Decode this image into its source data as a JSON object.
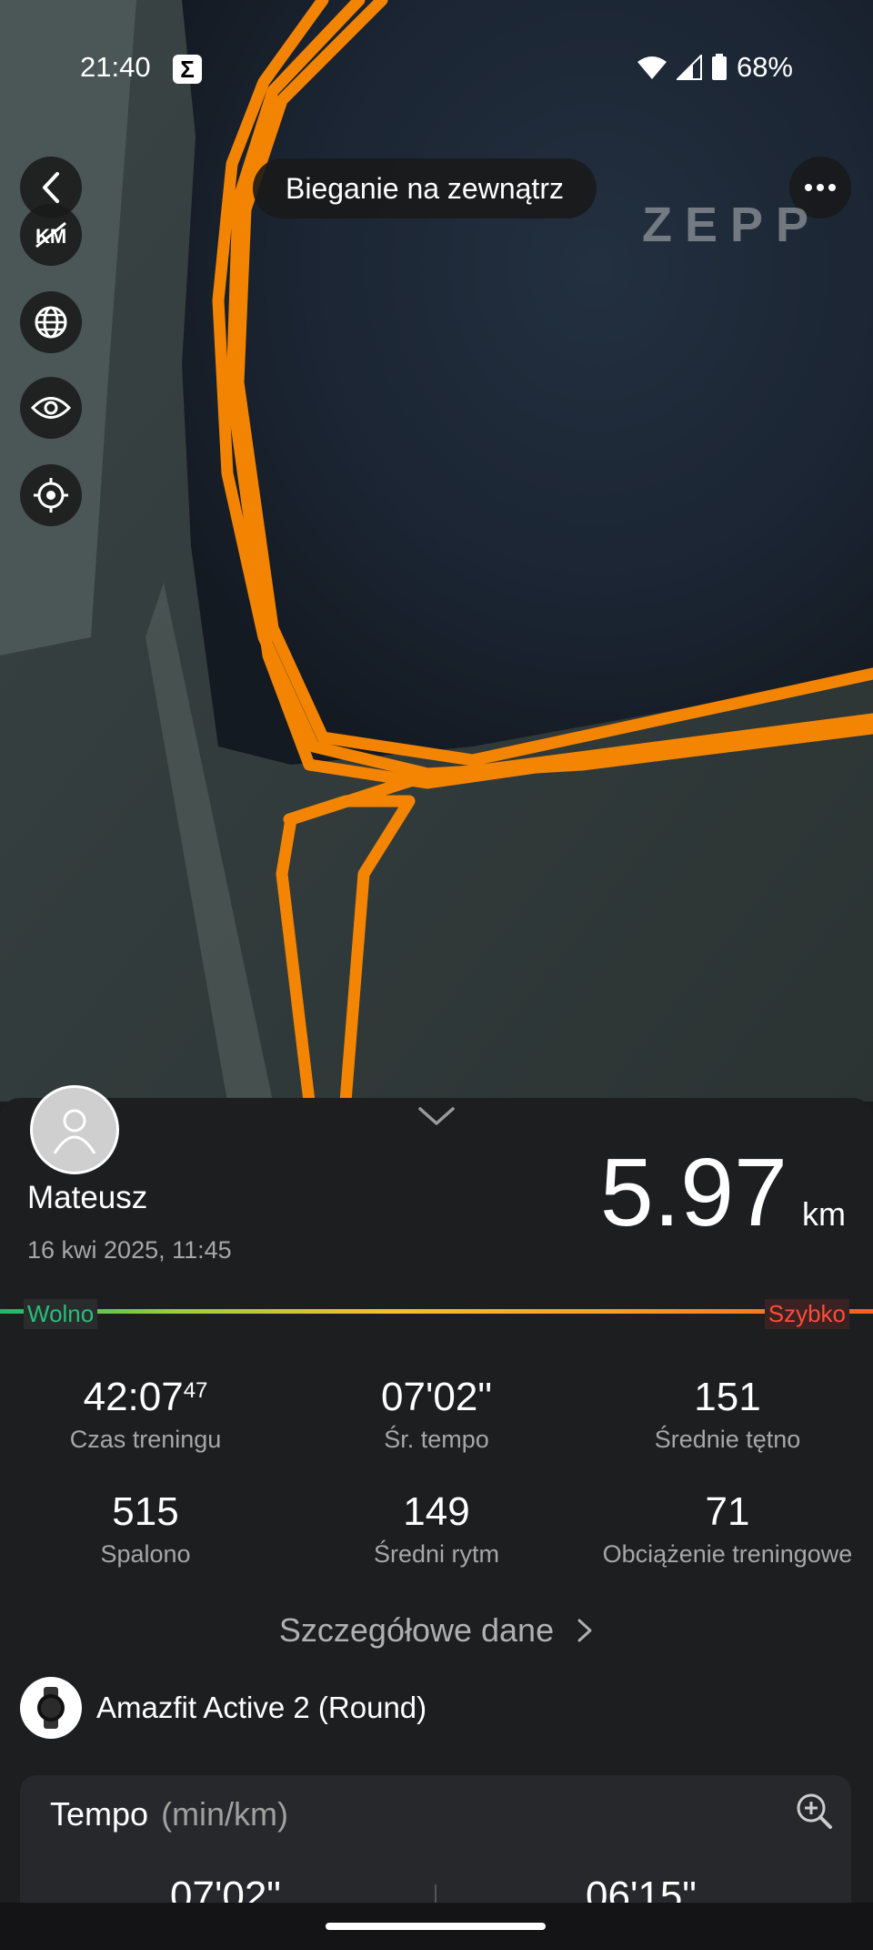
{
  "status_bar": {
    "time": "21:40",
    "battery": "68%"
  },
  "header": {
    "title": "Bieganie na zewnątrz",
    "brand": "ZEPP"
  },
  "map_controls": [
    "km-toggle-icon",
    "globe-icon",
    "eye-icon",
    "locate-icon"
  ],
  "summary": {
    "user": "Mateusz",
    "datetime": "16 kwi 2025, 11:45",
    "distance_value": "5.97",
    "distance_unit": "km"
  },
  "pace_scale": {
    "slow": "Wolno",
    "fast": "Szybko"
  },
  "stats": [
    {
      "value": "42:07",
      "sup": "47",
      "label": "Czas treningu"
    },
    {
      "value": "07'02\"",
      "label": "Śr. tempo"
    },
    {
      "value": "151",
      "label": "Średnie tętno"
    },
    {
      "value": "515",
      "label": "Spalono"
    },
    {
      "value": "149",
      "label": "Średni rytm"
    },
    {
      "value": "71",
      "label": "Obciążenie treningowe"
    }
  ],
  "details_link": "Szczegółowe dane",
  "device": {
    "name": "Amazfit Active 2 (Round)"
  },
  "pace_card": {
    "title": "Tempo",
    "unit": "(min/km)",
    "values": [
      "07'02\"",
      "06'15\""
    ]
  },
  "colors": {
    "route": "#ff8a00",
    "background": "#1d1e20",
    "slow": "#26c07a",
    "fast": "#ff4b3a"
  }
}
